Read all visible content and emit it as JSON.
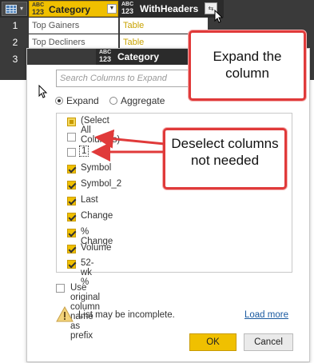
{
  "grid": {
    "category_col": {
      "type_top": "ABC",
      "type_bottom": "123",
      "name": "Category"
    },
    "withheaders_col": {
      "type_top": "ABC",
      "type_bottom": "123",
      "name": "WithHeaders"
    },
    "rows": [
      {
        "num": "1",
        "category": "Top Gainers",
        "value": "Table"
      },
      {
        "num": "2",
        "category": "Top Decliners",
        "value": "Table"
      },
      {
        "num": "3",
        "category": "",
        "value": ""
      }
    ]
  },
  "dialog": {
    "header": {
      "type_top": "ABC",
      "type_bottom": "123",
      "name": "Category"
    },
    "search_placeholder": "Search Columns to Expand",
    "radio_expand": "Expand",
    "radio_aggregate": "Aggregate",
    "columns": [
      {
        "label": "(Select All Columns)",
        "state": "partial"
      },
      {
        "label": "",
        "state": "off"
      },
      {
        "label": "1",
        "state": "off"
      },
      {
        "label": "Symbol",
        "state": "on"
      },
      {
        "label": "Symbol_2",
        "state": "on"
      },
      {
        "label": "Last",
        "state": "on"
      },
      {
        "label": "Change",
        "state": "on"
      },
      {
        "label": "% Change",
        "state": "on"
      },
      {
        "label": "Volume",
        "state": "on"
      },
      {
        "label": "52-wk %",
        "state": "on"
      }
    ],
    "prefix_label": "Use original column name as prefix",
    "warning_text": "List may be incomplete.",
    "load_more": "Load more",
    "ok_label": "OK",
    "cancel_label": "Cancel"
  },
  "callouts": {
    "expand_text": "Expand the column",
    "deselect_text": "Deselect columns not needed"
  },
  "colors": {
    "accent": "#f0c000",
    "callout_border": "#e03a3a",
    "dark": "#2b2b2b"
  }
}
